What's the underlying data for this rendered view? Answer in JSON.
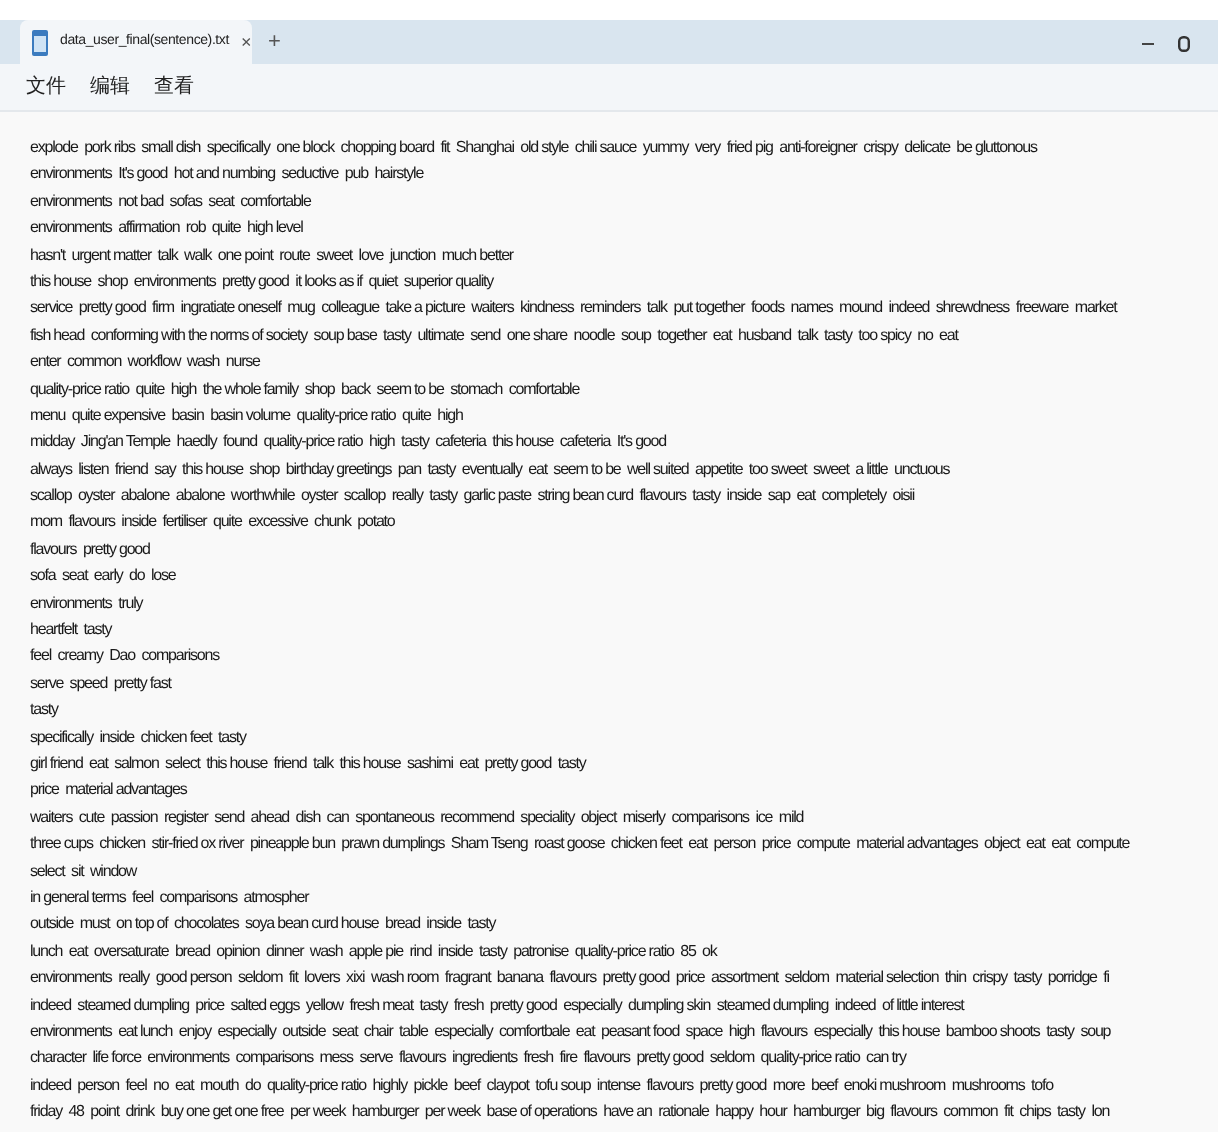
{
  "window": {
    "tab_title": "data_user_final(sentence).txt",
    "close_tab": "×",
    "new_tab": "+"
  },
  "menu": [
    "文件",
    "编辑",
    "查看"
  ],
  "lines": [
    "explode  pork ribs  small dish  specifically  one block  chopping board  fit  Shanghai  old style  chili sauce  yummy  very  fried pig  anti-foreigner  crispy  delicate  be gluttonous",
    "environments  It's good  hot and numbing  seductive  pub  hairstyle",
    "environments  not bad  sofas  seat  comfortable",
    "environments  affirmation  rob  quite  high level",
    "hasn't  urgent matter  talk  walk  one point  route  sweet  love  junction  much better",
    "this house  shop  environments  pretty good  it looks as if  quiet  superior quality",
    "service  pretty good  firm  ingratiate oneself  mug  colleague  take a picture  waiters  kindness  reminders  talk  put together  foods  names  mound  indeed  shrewdness  freeware  market",
    "fish head  conforming with the norms of society  soup base  tasty  ultimate  send  one share  noodle  soup  together  eat  husband  talk  tasty  too spicy  no  eat",
    "enter  common  workflow  wash  nurse",
    "quality-price ratio  quite  high  the whole family  shop  back  seem to be  stomach  comfortable",
    "menu  quite expensive  basin  basin volume  quality-price ratio  quite  high",
    "midday  Jing'an Temple  haedly  found  quality-price ratio  high  tasty  cafeteria  this house  cafeteria  It's good",
    "always  listen  friend  say  this house  shop  birthday greetings  pan  tasty  eventually  eat  seem to be  well suited  appetite  too sweet  sweet  a little  unctuous",
    "scallop  oyster  abalone  abalone  worthwhile  oyster  scallop  really  tasty  garlic paste  string bean curd  flavours  tasty  inside  sap  eat  completely  oisii",
    "mom  flavours  inside  fertiliser  quite  excessive  chunk  potato",
    "flavours  pretty good",
    "sofa  seat  early  do  lose",
    "environments  truly",
    "heartfelt  tasty",
    "feel  creamy  Dao  comparisons",
    "serve  speed  pretty fast",
    "tasty",
    "specifically  inside  chicken feet  tasty",
    "girl friend  eat  salmon  select  this house  friend  talk  this house  sashimi  eat  pretty good  tasty",
    "price  material advantages",
    "waiters  cute  passion  register  send  ahead  dish  can  spontaneous  recommend  speciality  object  miserly  comparisons  ice  mild",
    "three cups  chicken  stir-fried ox river  pineapple bun  prawn dumplings  Sham Tseng  roast goose  chicken feet  eat  person  price  compute  material advantages  object  eat  eat  compute",
    "select  sit  window",
    "in general terms  feel  comparisons  atmospher",
    "outside  must  on top of  chocolates  soya bean curd house  bread  inside  tasty",
    "lunch  eat  oversaturate  bread  opinion  dinner  wash  apple pie  rind  inside  tasty  patronise  quality-price ratio  85  ok",
    "environments  really  good person  seldom  fit  lovers  xixi  wash room  fragrant  banana  flavours  pretty good  price  assortment  seldom  material selection  thin  crispy  tasty  porridge  fi",
    "indeed  steamed dumpling  price  salted eggs  yellow  fresh meat  tasty  fresh  pretty good  especially  dumpling skin  steamed dumpling  indeed  of little interest",
    "environments  eat lunch  enjoy  especially  outside  seat  chair  table  especially  comfortbale  eat  peasant food  space  high  flavours  especially  this house  bamboo shoots  tasty  soup",
    "character  life force  environments  comparisons  mess  serve  flavours  ingredients  fresh  fire  flavours  pretty good  seldom  quality-price ratio  can try",
    "indeed  person  feel  no  eat  mouth  do  quality-price ratio  highly  pickle  beef  claypot  tofu soup  intense  flavours  pretty good  more  beef  enoki mushroom  mushrooms  tofo",
    "friday  48  point  drink  buy one get one free  per week  hamburger  per week  base of operations  have an  rationale  happy  hour  hamburger  big  flavours  common  fit  chips  tasty  lon"
  ]
}
